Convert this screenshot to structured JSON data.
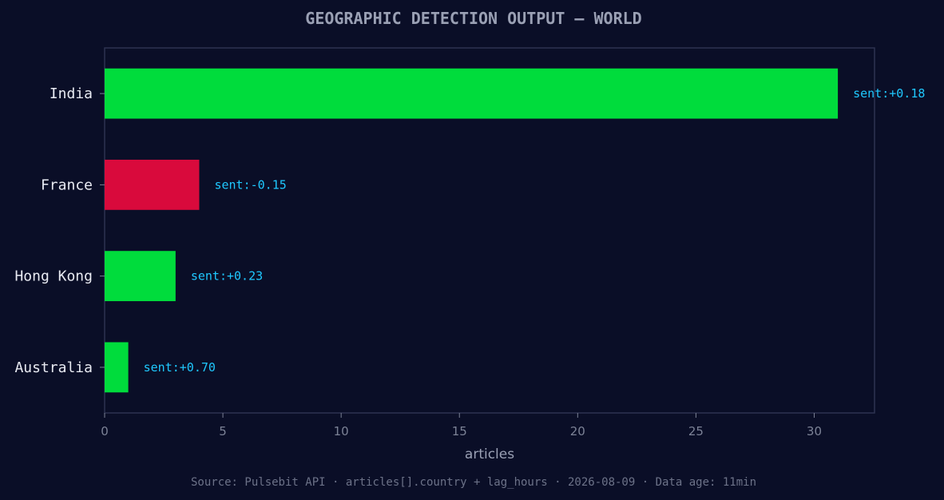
{
  "chart_data": {
    "type": "bar",
    "orientation": "horizontal",
    "title": "GEOGRAPHIC DETECTION OUTPUT — WORLD",
    "xlabel": "articles",
    "ylabel": "",
    "categories": [
      "India",
      "France",
      "Hong Kong",
      "Australia"
    ],
    "values": [
      31,
      4,
      3,
      1
    ],
    "labels": [
      "sent:+0.18",
      "sent:-0.15",
      "sent:+0.23",
      "sent:+0.70"
    ],
    "bar_colors": [
      "#00dc3c",
      "#d90a3c",
      "#00dc3c",
      "#00dc3c"
    ],
    "xlim": [
      0,
      32.55
    ],
    "xticks": [
      0,
      5,
      10,
      15,
      20,
      25,
      30
    ],
    "grid": false,
    "legend": "none",
    "footer": "Source: Pulsebit API · articles[].country + lag_hours · 2026-08-09 · Data age: 11min"
  },
  "colors": {
    "background": "#0a0e27",
    "frame": "#2c3250",
    "positive": "#00dc3c",
    "negative": "#d90a3c",
    "annotation": "#1fc8ff"
  }
}
